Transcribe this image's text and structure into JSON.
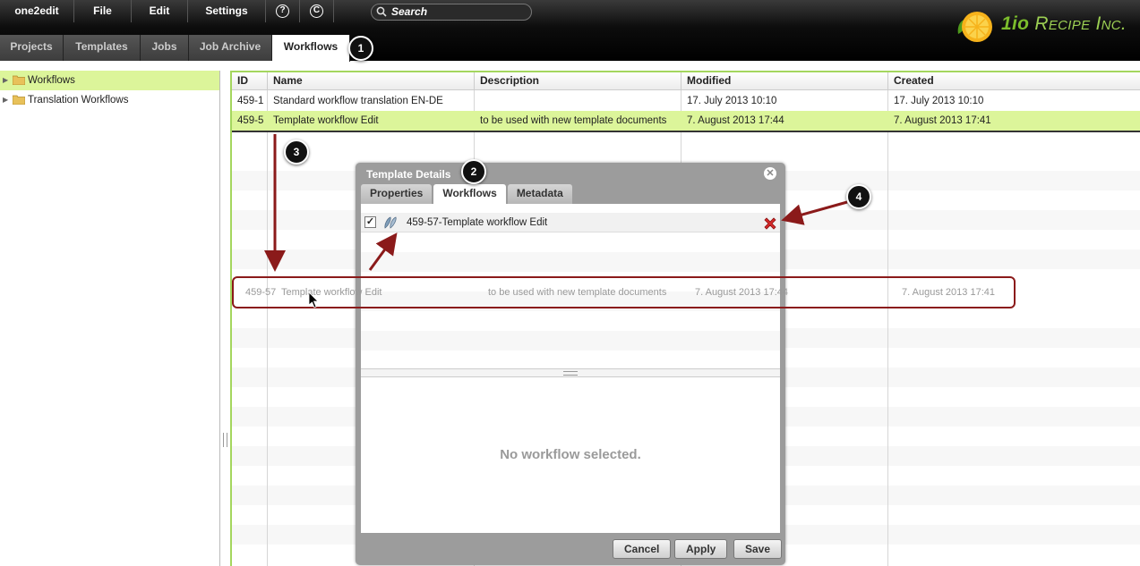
{
  "menu": {
    "items": [
      "one2edit",
      "File",
      "Edit",
      "Settings"
    ],
    "help_icon": "help-icon",
    "refresh_icon": "refresh-icon"
  },
  "search": {
    "placeholder": "Search"
  },
  "logo": {
    "prefix": "1io",
    "name": "Recipe Inc."
  },
  "tabs": [
    "Projects",
    "Templates",
    "Jobs",
    "Job Archive",
    "Workflows"
  ],
  "active_tab": "Workflows",
  "tree": {
    "items": [
      {
        "label": "Workflows",
        "selected": true
      },
      {
        "label": "Translation Workflows",
        "selected": false
      }
    ]
  },
  "grid": {
    "columns": [
      "ID",
      "Name",
      "Description",
      "Modified",
      "Created"
    ],
    "rows": [
      {
        "id": "459-1",
        "name": "Standard workflow translation EN-DE",
        "description": "",
        "modified": "17. July 2013 10:10",
        "created": "17. July 2013 10:10"
      },
      {
        "id": "459-5",
        "name": "Template workflow Edit",
        "description": "to be used with new template documents",
        "modified": "7. August 2013 17:44",
        "created": "7. August 2013 17:41"
      }
    ]
  },
  "drag_ghost": {
    "id": "459-57",
    "name": "Template workflow Edit",
    "description": "to be used with new template documents",
    "modified": "7. August 2013 17:44",
    "created": "7. August 2013 17:41"
  },
  "dialog": {
    "title": "Template Details",
    "tabs": [
      "Properties",
      "Workflows",
      "Metadata"
    ],
    "active_tab": "Workflows",
    "workflow_item": {
      "label": "459-57-Template workflow Edit",
      "checked": true
    },
    "empty_message": "No workflow selected.",
    "buttons": {
      "cancel": "Cancel",
      "apply": "Apply",
      "save": "Save"
    }
  },
  "annotations": [
    "1",
    "2",
    "3",
    "4"
  ],
  "colors": {
    "accent_green": "#a4d65e",
    "selection": "#dcf59a",
    "annotation_arrow": "#8b1a1a",
    "logo": "#7cbd2c"
  }
}
